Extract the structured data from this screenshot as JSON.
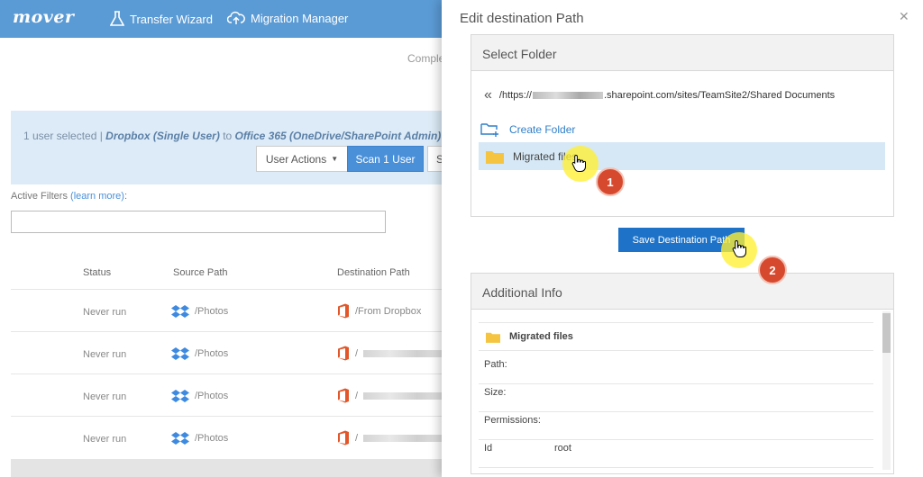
{
  "navbar": {
    "logo": "mover",
    "items": [
      {
        "label": "Transfer Wizard",
        "icon": "flask-icon"
      },
      {
        "label": "Migration Manager",
        "icon": "cloud-upload-icon"
      }
    ],
    "bg_color": "#5b9bd5"
  },
  "page": {
    "complete_text": "Comple",
    "selection": {
      "prefix": "1 user selected | ",
      "source": "Dropbox (Single User)",
      "connector": " to ",
      "destination": "Office 365 (OneDrive/SharePoint Admin)"
    },
    "buttons": {
      "user_actions": "User Actions",
      "scan": "Scan 1 User",
      "cut_button": "S"
    },
    "filters": {
      "label": "Active Filters",
      "link": "(learn more)",
      "colon": ":",
      "value": ""
    },
    "table": {
      "columns": [
        "Status",
        "Source Path",
        "Destination Path"
      ],
      "rows": [
        {
          "status": "Never run",
          "source": "/Photos",
          "destination": "/From Dropbox"
        },
        {
          "status": "Never run",
          "source": "/Photos",
          "destination": "/"
        },
        {
          "status": "Never run",
          "source": "/Photos",
          "destination": "/"
        },
        {
          "status": "Never run",
          "source": "/Photos",
          "destination": "/"
        }
      ]
    }
  },
  "panel": {
    "title": "Edit destination Path",
    "select_folder": {
      "header": "Select Folder",
      "path_prefix": "/https://",
      "path_suffix": ".sharepoint.com/sites/TeamSite2/Shared Documents",
      "create_folder": "Create Folder",
      "folder_name": "Migrated files"
    },
    "save_button": "Save Destination Path",
    "additional_info": {
      "header": "Additional Info",
      "name": "Migrated files",
      "fields": [
        {
          "label": "Path:",
          "value": ""
        },
        {
          "label": "Size:",
          "value": ""
        },
        {
          "label": "Permissions:",
          "value": ""
        },
        {
          "label": "Id",
          "value": "root"
        }
      ]
    }
  },
  "annotations": {
    "step1": "1",
    "step2": "2",
    "badge_color": "#d7492f",
    "highlight_color": "#fff032"
  }
}
